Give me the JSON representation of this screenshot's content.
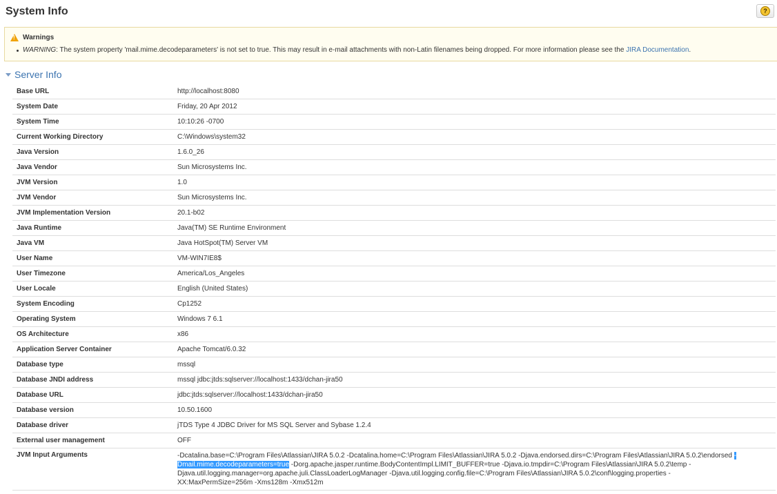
{
  "page": {
    "title": "System Info"
  },
  "help": {
    "icon": "help-icon",
    "glyph": "?"
  },
  "warnings": {
    "heading": "Warnings",
    "items": [
      {
        "label": "WARNING",
        "text_before": ": The system property 'mail.mime.decodeparameters' is not set to true. This may result in e-mail attachments with non-Latin filenames being dropped. For more information please see the ",
        "link_text": "JIRA Documentation",
        "text_after": "."
      }
    ]
  },
  "section": {
    "title": "Server Info"
  },
  "server_info": [
    {
      "key": "Base URL",
      "value": "http://localhost:8080"
    },
    {
      "key": "System Date",
      "value": "Friday, 20 Apr 2012"
    },
    {
      "key": "System Time",
      "value": "10:10:26 -0700"
    },
    {
      "key": "Current Working Directory",
      "value": "C:\\Windows\\system32"
    },
    {
      "key": "Java Version",
      "value": "1.6.0_26"
    },
    {
      "key": "Java Vendor",
      "value": "Sun Microsystems Inc."
    },
    {
      "key": "JVM Version",
      "value": "1.0"
    },
    {
      "key": "JVM Vendor",
      "value": "Sun Microsystems Inc."
    },
    {
      "key": "JVM Implementation Version",
      "value": "20.1-b02"
    },
    {
      "key": "Java Runtime",
      "value": "Java(TM) SE Runtime Environment"
    },
    {
      "key": "Java VM",
      "value": "Java HotSpot(TM) Server VM"
    },
    {
      "key": "User Name",
      "value": "VM-WIN7IE8$"
    },
    {
      "key": "User Timezone",
      "value": "America/Los_Angeles"
    },
    {
      "key": "User Locale",
      "value": "English (United States)"
    },
    {
      "key": "System Encoding",
      "value": "Cp1252"
    },
    {
      "key": "Operating System",
      "value": "Windows 7 6.1"
    },
    {
      "key": "OS Architecture",
      "value": "x86"
    },
    {
      "key": "Application Server Container",
      "value": "Apache Tomcat/6.0.32"
    },
    {
      "key": "Database type",
      "value": "mssql"
    },
    {
      "key": "Database JNDI address",
      "value": "mssql jdbc:jtds:sqlserver://localhost:1433/dchan-jira50"
    },
    {
      "key": "Database URL",
      "value": "jdbc:jtds:sqlserver://localhost:1433/dchan-jira50"
    },
    {
      "key": "Database version",
      "value": "10.50.1600"
    },
    {
      "key": "Database driver",
      "value": "jTDS Type 4 JDBC Driver for MS SQL Server and Sybase 1.2.4"
    },
    {
      "key": "External user management",
      "value": "OFF"
    }
  ],
  "jvm_args": {
    "key": "JVM Input Arguments",
    "line1": "-Dcatalina.base=C:\\Program Files\\Atlassian\\JIRA 5.0.2 -Dcatalina.home=C:\\Program Files\\Atlassian\\JIRA 5.0.2 -Djava.endorsed.dirs=C:\\Program Files\\Atlassian\\JIRA 5.0.2\\endorsed ",
    "line1_highlight": " -",
    "line2_highlight": "Dmail.mime.decodeparameters=true",
    "line2_rest": " -Dorg.apache.jasper.runtime.BodyContentImpl.LIMIT_BUFFER=true -Djava.io.tmpdir=C:\\Program Files\\Atlassian\\JIRA 5.0.2\\temp -",
    "line3": "Djava.util.logging.manager=org.apache.juli.ClassLoaderLogManager -Djava.util.logging.config.file=C:\\Program Files\\Atlassian\\JIRA 5.0.2\\conf\\logging.properties -",
    "line4": "XX:MaxPermSize=256m -Xms128m -Xmx512m"
  },
  "colors": {
    "link": "#3b73af",
    "warning_bg": "#fffdf0",
    "warning_border": "#e8d9a0",
    "selection": "#3399ff"
  }
}
